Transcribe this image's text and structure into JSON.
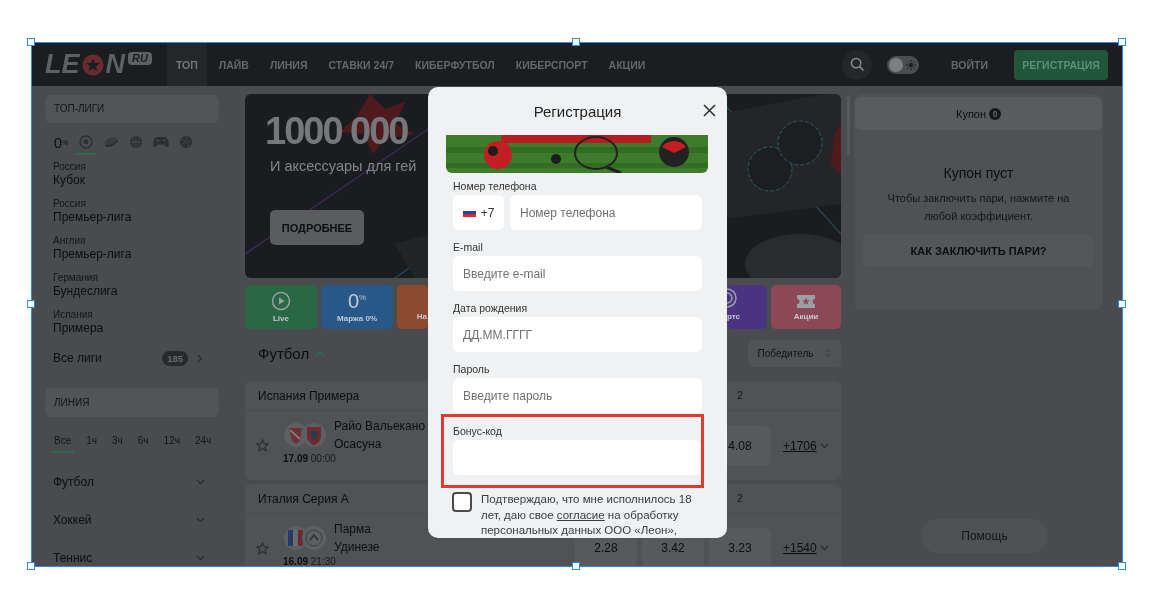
{
  "header": {
    "logo": {
      "left": "LE",
      "right": "N",
      "badge": "RU"
    },
    "nav": [
      {
        "label": "ТОП",
        "selected": true
      },
      {
        "label": "ЛАЙВ",
        "selected": false
      },
      {
        "label": "ЛИНИЯ",
        "selected": false
      },
      {
        "label": "СТАВКИ 24/7",
        "selected": false
      },
      {
        "label": "КИБЕРФУТБОЛ",
        "selected": false
      },
      {
        "label": "КИБЕРСПОРТ",
        "selected": false
      },
      {
        "label": "АКЦИИ",
        "selected": false
      }
    ],
    "theme_toggle": {
      "on": false
    },
    "login": "ВОЙТИ",
    "register": "РЕГИСТРАЦИЯ"
  },
  "sidebar": {
    "top_leagues": {
      "title": "ТОП-ЛИГИ",
      "sport_tabs": [
        {
          "kind": "margin",
          "label": "0$^{%}$",
          "selected": false
        },
        {
          "kind": "football",
          "selected": true
        },
        {
          "kind": "hockey",
          "selected": false
        },
        {
          "kind": "basketball",
          "selected": false
        },
        {
          "kind": "esports",
          "selected": false
        },
        {
          "kind": "volleyball",
          "selected": false
        }
      ],
      "leagues": [
        {
          "country": "Россия",
          "name": "Кубок"
        },
        {
          "country": "Россия",
          "name": "Премьер-лига"
        },
        {
          "country": "Англия",
          "name": "Премьер-лига"
        },
        {
          "country": "Германия",
          "name": "Бундеслига"
        },
        {
          "country": "Испания",
          "name": "Примера"
        }
      ],
      "all_leagues": {
        "label": "Все лиги",
        "count": "185"
      }
    },
    "line": {
      "title": "ЛИНИЯ",
      "periods": [
        {
          "label": "Все",
          "selected": true
        },
        {
          "label": "1ч",
          "selected": false
        },
        {
          "label": "3ч",
          "selected": false
        },
        {
          "label": "6ч",
          "selected": false
        },
        {
          "label": "12ч",
          "selected": false
        },
        {
          "label": "24ч",
          "selected": false
        }
      ],
      "sports": [
        "Футбол",
        "Хоккей",
        "Теннис"
      ]
    }
  },
  "banner": {
    "amount": "1000 000",
    "subtitle": "И аксессуары для гей",
    "button": "ПОДРОБНЕЕ"
  },
  "tiles": [
    {
      "kind": "live",
      "label": "Live",
      "color": "#2a6845"
    },
    {
      "kind": "margin",
      "label": "Маржа 0%",
      "icon_text": "0$^{%}$",
      "color": "#285888"
    },
    {
      "kind": "cut_left",
      "label": "На",
      "color": "#8c4a2f"
    },
    {
      "kind": "cut_right",
      "label": "ртс",
      "color": "#4a3380"
    },
    {
      "kind": "promo",
      "label": "Акции",
      "color": "#8c4955"
    }
  ],
  "sport_section": {
    "title": "Футбол",
    "market": "Победитель",
    "leagues": [
      {
        "name": "Испания Примера",
        "columns": [
          "2"
        ],
        "matches": [
          {
            "team1": "Райо Вальекано",
            "team2": "Осасуна",
            "date": "17.09",
            "time": "00:00",
            "odds": [
              "4.08"
            ],
            "more": "+1706"
          }
        ]
      },
      {
        "name": "Италия Серия А",
        "columns": [
          "2"
        ],
        "matches": [
          {
            "team1": "Парма",
            "team2": "Удинезе",
            "date": "16.09",
            "time": "21:30",
            "odds": [
              "2.28",
              "3.42",
              "3.23"
            ],
            "more": "+1540"
          }
        ]
      }
    ]
  },
  "coupon": {
    "title": "Купон",
    "count": "0",
    "empty_title": "Купон пуст",
    "empty_text": "Чтобы заключить пари, нажмите на любой коэффициент.",
    "how_button": "КАК ЗАКЛЮЧИТЬ ПАРИ?"
  },
  "help_button": "Помощь",
  "modal": {
    "title": "Регистрация",
    "fields": [
      {
        "kind": "phone",
        "label": "Номер телефона",
        "code": "+7",
        "placeholder": "Номер телефона",
        "highlighted": false
      },
      {
        "kind": "email",
        "label": "E-mail",
        "placeholder": "Введите e-mail",
        "highlighted": false
      },
      {
        "kind": "date",
        "label": "Дата рождения",
        "placeholder": "ДД.ММ.ГГГГ",
        "highlighted": false
      },
      {
        "kind": "password",
        "label": "Пароль",
        "placeholder": "Введите пароль",
        "highlighted": false
      },
      {
        "kind": "text",
        "label": "Бонус-код",
        "highlighted": true
      }
    ],
    "consent": {
      "checked": false,
      "text": "Подтверждаю, что мне исполнилось 18 лет, даю свое ",
      "link": "согласие",
      "text_after": " на обработку персональных данных ООО «Леон»,"
    }
  }
}
